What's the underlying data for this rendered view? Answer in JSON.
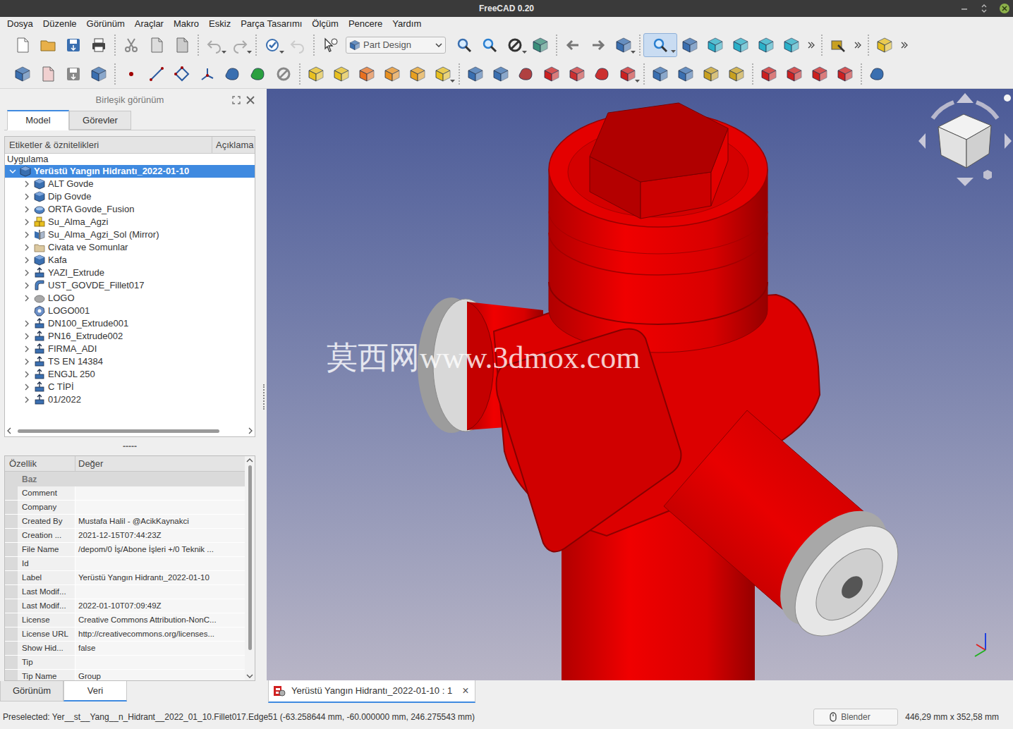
{
  "window": {
    "title": "FreeCAD 0.20"
  },
  "menu": [
    "Dosya",
    "Düzenle",
    "Görünüm",
    "Araçlar",
    "Makro",
    "Eskiz",
    "Parça Tasarımı",
    "Ölçüm",
    "Pencere",
    "Yardım"
  ],
  "toolbar": {
    "workbench": "Part Design"
  },
  "combo_view": {
    "title": "Birleşik görünüm",
    "tabs": [
      {
        "label": "Model",
        "selected": true
      },
      {
        "label": "Görevler",
        "selected": false
      }
    ]
  },
  "tree": {
    "columns": [
      "Etiketler & öznitelikleri",
      "Açıklama"
    ],
    "group": "Uygulama",
    "root": {
      "label": "Yerüstü Yangın Hidrantı_2022-01-10",
      "selected": true,
      "expanded": true
    },
    "items": [
      {
        "label": "ALT Govde",
        "kind": "body",
        "has_children": true,
        "expanded": false,
        "selected": false
      },
      {
        "label": "Dip Govde",
        "kind": "body",
        "has_children": true,
        "expanded": false,
        "selected": false
      },
      {
        "label": "ORTA Govde_Fusion",
        "kind": "fusion",
        "has_children": true,
        "expanded": false,
        "selected": false
      },
      {
        "label": "Su_Alma_Agzi",
        "kind": "part",
        "has_children": true,
        "expanded": false,
        "selected": false
      },
      {
        "label": "Su_Alma_Agzi_Sol (Mirror)",
        "kind": "mirror",
        "has_children": true,
        "expanded": false,
        "selected": false
      },
      {
        "label": "Civata ve Somunlar",
        "kind": "folder",
        "has_children": true,
        "expanded": false,
        "selected": false
      },
      {
        "label": "Kafa",
        "kind": "body",
        "has_children": true,
        "expanded": false,
        "selected": false
      },
      {
        "label": "YAZI_Extrude",
        "kind": "extrude",
        "has_children": true,
        "expanded": false,
        "selected": false
      },
      {
        "label": "UST_GOVDE_Fillet017",
        "kind": "fillet",
        "has_children": true,
        "expanded": false,
        "selected": false
      },
      {
        "label": "LOGO",
        "kind": "shape",
        "has_children": true,
        "expanded": false,
        "selected": false
      },
      {
        "label": "LOGO001",
        "kind": "clone",
        "has_children": false,
        "expanded": false,
        "selected": false
      },
      {
        "label": "DN100_Extrude001",
        "kind": "extrude",
        "has_children": true,
        "expanded": false,
        "selected": false
      },
      {
        "label": "PN16_Extrude002",
        "kind": "extrude",
        "has_children": true,
        "expanded": false,
        "selected": false
      },
      {
        "label": "FIRMA_ADI",
        "kind": "extrude",
        "has_children": true,
        "expanded": false,
        "selected": false
      },
      {
        "label": "TS EN 14384",
        "kind": "extrude",
        "has_children": true,
        "expanded": false,
        "selected": false
      },
      {
        "label": "ENGJL 250",
        "kind": "extrude",
        "has_children": true,
        "expanded": false,
        "selected": false
      },
      {
        "label": "C TİPİ",
        "kind": "extrude",
        "has_children": true,
        "expanded": false,
        "selected": false
      },
      {
        "label": "01/2022",
        "kind": "extrude",
        "has_children": true,
        "expanded": false,
        "selected": false
      }
    ]
  },
  "splitter": "-----",
  "properties": {
    "columns": [
      "Özellik",
      "Değer"
    ],
    "group": "Baz",
    "rows": [
      [
        "Comment",
        ""
      ],
      [
        "Company",
        ""
      ],
      [
        "Created By",
        "Mustafa Halil - @AcikKaynakci"
      ],
      [
        "Creation ...",
        "2021-12-15T07:44:23Z"
      ],
      [
        "File Name",
        "/depom/0 İş/Abone İşleri +/0 Teknik ..."
      ],
      [
        "Id",
        ""
      ],
      [
        "Label",
        "Yerüstü Yangın Hidrantı_2022-01-10"
      ],
      [
        "Last Modif...",
        ""
      ],
      [
        "Last Modif...",
        "2022-01-10T07:09:49Z"
      ],
      [
        "License",
        "Creative Commons Attribution-NonC..."
      ],
      [
        "License URL",
        "http://creativecommons.org/licenses..."
      ],
      [
        "Show Hid...",
        "false"
      ],
      [
        "Tip",
        ""
      ],
      [
        "Tip Name",
        "Group"
      ]
    ]
  },
  "panel_tabs": [
    {
      "label": "Görünüm",
      "selected": false
    },
    {
      "label": "Veri",
      "selected": true
    }
  ],
  "viewport": {
    "watermark": "莫西网www.3dmox.com"
  },
  "document_tabs": [
    {
      "label": "Yerüstü Yangın Hidrantı_2022-01-10 : 1",
      "selected": true,
      "close": "×"
    }
  ],
  "status_bar": {
    "message": "Preselected: Yer__st__Yang__n_Hidrant__2022_01_10.Fillet017.Edge51 (-63.258644 mm, -60.000000 mm, 246.275543 mm)",
    "navigation": "Blender",
    "dimensions": "446,29 mm x 352,58 mm"
  }
}
